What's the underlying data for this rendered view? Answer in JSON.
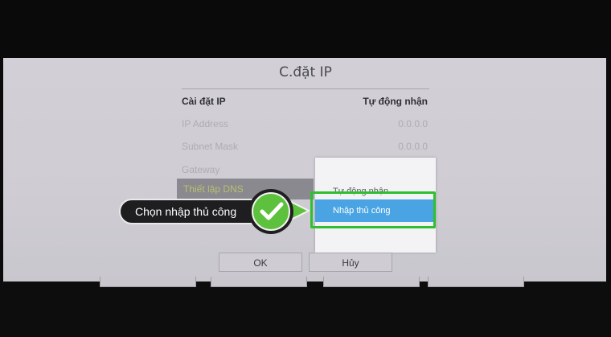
{
  "dialog": {
    "title": "C.đặt IP",
    "header_row": {
      "label": "Cài đặt IP",
      "value": "Tự động nhận"
    },
    "rows": [
      {
        "label": "IP Address",
        "value": "0.0.0.0"
      },
      {
        "label": "Subnet Mask",
        "value": "0.0.0.0"
      },
      {
        "label": "Gateway",
        "value": ""
      }
    ],
    "dns_row": {
      "label": "Thiết lập DNS"
    },
    "dropdown": {
      "options": [
        "Tự động nhận",
        "Nhập thủ công"
      ],
      "selected": "Nhập thủ công"
    },
    "ok_label": "OK",
    "cancel_label": "Hủy"
  },
  "annotation": {
    "callout_text": "Chọn nhập thủ công",
    "highlight_color": "#2fbf2f"
  },
  "colors": {
    "accent_blue": "#4aa4e4",
    "check_green": "#5ec13e"
  }
}
